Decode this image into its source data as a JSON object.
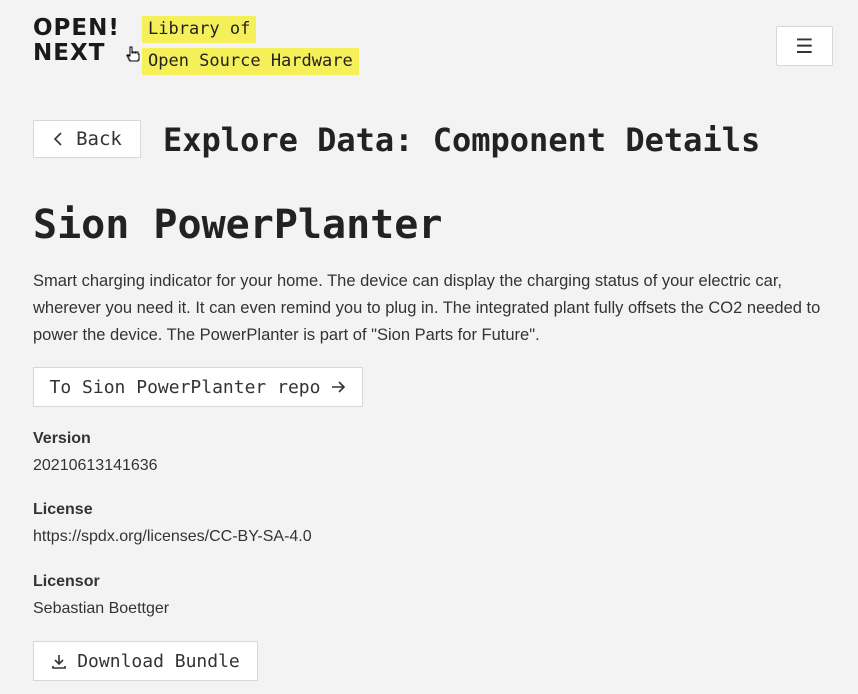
{
  "header": {
    "logo_line1": "OPEN!",
    "logo_line2": "NEXT",
    "tagline_line1": "Library of",
    "tagline_line2": "Open Source Hardware",
    "menu_icon": "☰"
  },
  "nav": {
    "back_label": "Back",
    "section_title": "Explore Data: Component Details"
  },
  "component": {
    "title": "Sion PowerPlanter",
    "description": "Smart charging indicator for your home. The device can display the charging status of your electric car, wherever you need it. It can even remind you to plug in. The integrated plant fully offsets the CO2 needed to power the device. The PowerPlanter is part of \"Sion Parts for Future\".",
    "repo_button_label": "To Sion PowerPlanter repo",
    "version_label": "Version",
    "version_value": "20210613141636",
    "license_label": "License",
    "license_value": "https://spdx.org/licenses/CC-BY-SA-4.0",
    "licensor_label": "Licensor",
    "licensor_value": "Sebastian Boettger",
    "download_label": "Download Bundle"
  },
  "icons": {
    "back": "chevron-left-icon",
    "repo": "arrow-right-icon",
    "download": "download-icon",
    "menu": "hamburger-menu-icon",
    "cursor": "hand-pointer-icon"
  },
  "colors": {
    "highlight": "#f5f05a",
    "background": "#f3f3f3"
  }
}
